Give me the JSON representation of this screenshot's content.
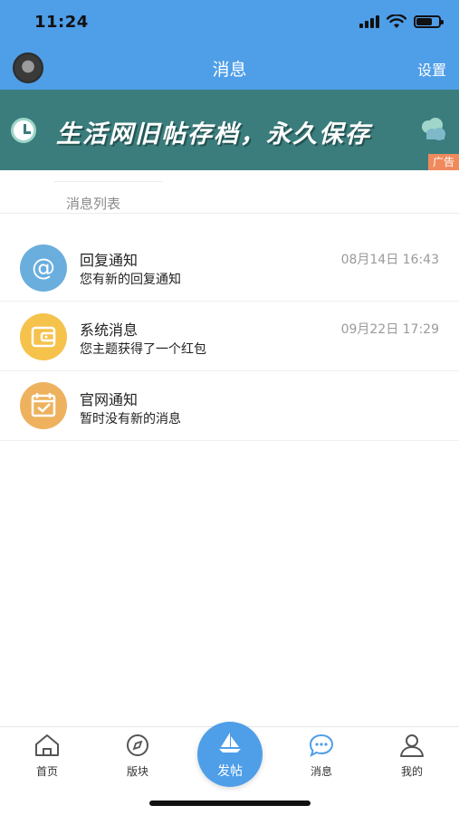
{
  "status_bar": {
    "time": "11:24"
  },
  "header": {
    "title": "消息",
    "settings_label": "设置"
  },
  "banner": {
    "text": "生活网旧帖存档，永久保存",
    "ad_label": "广告"
  },
  "section": {
    "title": "消息列表"
  },
  "messages": [
    {
      "title": "回复通知",
      "subtitle": "您有新的回复通知",
      "time": "08月14日 16:43",
      "icon": "at-icon",
      "color": "#6aaede"
    },
    {
      "title": "系统消息",
      "subtitle": "您主题获得了一个红包",
      "time": "09月22日 17:29",
      "icon": "wallet-icon",
      "color": "#f5c24c"
    },
    {
      "title": "官网通知",
      "subtitle": "暂时没有新的消息",
      "time": "",
      "icon": "calendar-icon",
      "color": "#eeb25e"
    }
  ],
  "tabbar": {
    "home_label": "首页",
    "forum_label": "版块",
    "post_label": "发帖",
    "messages_label": "消息",
    "mine_label": "我的"
  },
  "colors": {
    "primary": "#4f9ee8",
    "banner_bg": "#3a7d7c",
    "ad_badge": "#f08a5d"
  }
}
